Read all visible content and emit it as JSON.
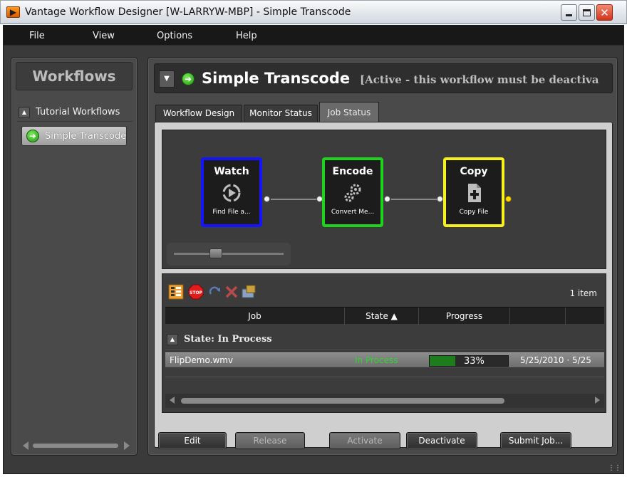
{
  "window": {
    "title": "Vantage Workflow Designer [W-LARRYW-MBP]  - Simple Transcode"
  },
  "menu": [
    "File",
    "View",
    "Options",
    "Help"
  ],
  "sidebar": {
    "header": "Workflows",
    "group_label": "Tutorial Workflows",
    "items": [
      {
        "label": "Simple Transcode"
      }
    ]
  },
  "workflow": {
    "name": "Simple Transcode",
    "status": "[Active - this workflow must be deactiva"
  },
  "tabs": [
    {
      "label": "Workflow Design",
      "active": false
    },
    {
      "label": "Monitor Status",
      "active": false
    },
    {
      "label": "Job Status",
      "active": true
    }
  ],
  "nodes": [
    {
      "title": "Watch",
      "subtitle": "Find File a...",
      "color": "#1414ff",
      "icon": "watch-icon"
    },
    {
      "title": "Encode",
      "subtitle": "Convert Me...",
      "color": "#1ed21e",
      "icon": "gears-icon"
    },
    {
      "title": "Copy",
      "subtitle": "Copy File",
      "color": "#f5f01e",
      "icon": "copy-file-icon"
    }
  ],
  "jobs_panel": {
    "item_count": "1 item",
    "columns": [
      "Job",
      "State ▲",
      "Progress",
      "",
      ""
    ],
    "group_label": "State: In Process",
    "rows": [
      {
        "job": "FlipDemo.wmv",
        "state": "In Process",
        "progress_text": "33%",
        "progress": 0.33,
        "date": "5/25/2010 · 5/25"
      }
    ]
  },
  "buttons": {
    "edit": "Edit",
    "release": "Release",
    "activate": "Activate",
    "deactivate": "Deactivate",
    "submit": "Submit Job..."
  },
  "colors": {
    "in_process": "#2fd62f",
    "progress_fill": "#1d7d1d"
  }
}
